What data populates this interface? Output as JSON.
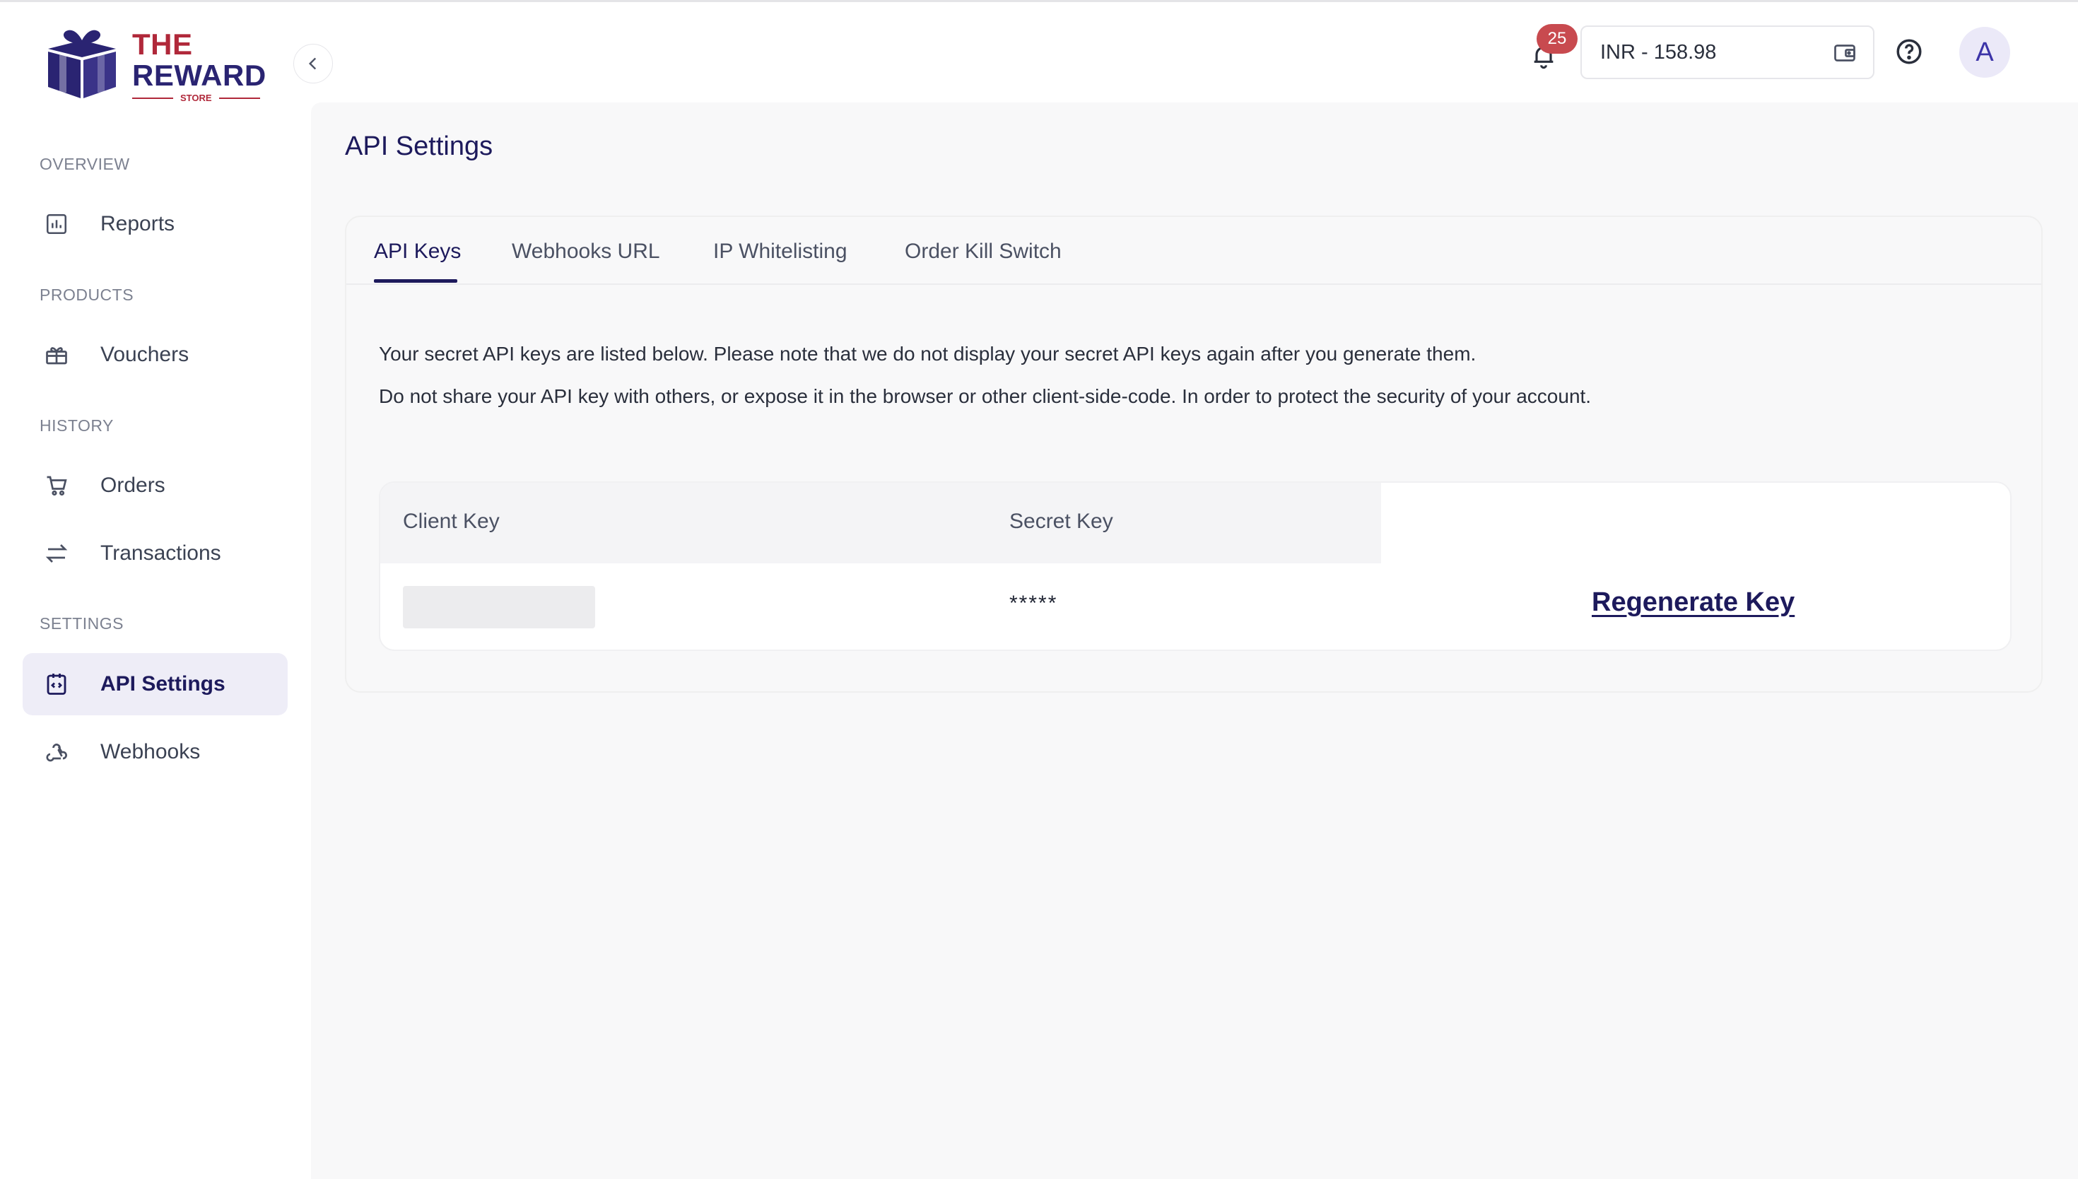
{
  "brand": {
    "line1": "THE",
    "line2": "REWARD",
    "line3": "STORE",
    "colors": {
      "red": "#b0283a",
      "navy": "#2a2472"
    }
  },
  "sidebar": {
    "sections": [
      {
        "label": "OVERVIEW",
        "items": [
          {
            "label": "Reports",
            "icon": "reports-icon"
          }
        ]
      },
      {
        "label": "PRODUCTS",
        "items": [
          {
            "label": "Vouchers",
            "icon": "gift-icon"
          }
        ]
      },
      {
        "label": "HISTORY",
        "items": [
          {
            "label": "Orders",
            "icon": "cart-icon"
          },
          {
            "label": "Transactions",
            "icon": "swap-arrows-icon"
          }
        ]
      },
      {
        "label": "SETTINGS",
        "items": [
          {
            "label": "API Settings",
            "icon": "api-code-icon",
            "active": true
          },
          {
            "label": "Webhooks",
            "icon": "webhook-icon"
          }
        ]
      }
    ]
  },
  "header": {
    "notification_count": "25",
    "wallet_value": "INR - 158.98",
    "avatar_letter": "A",
    "colors": {
      "badge": "#c84a4f",
      "avatar_bg": "#ebe9f8",
      "accent": "#1d1a5c"
    }
  },
  "main": {
    "title": "API Settings",
    "tabs": [
      {
        "label": "API Keys",
        "active": true
      },
      {
        "label": "Webhooks URL"
      },
      {
        "label": "IP Whitelisting"
      },
      {
        "label": "Order Kill Switch"
      }
    ],
    "description": [
      "Your secret API keys are listed below. Please note that we do not display your secret API keys again after you generate them.",
      "Do not share your API key with others, or expose it in the browser or other client-side-code. In order to protect the security of your account."
    ],
    "table": {
      "headers": [
        "Client Key",
        "Secret Key"
      ],
      "row": {
        "client_key": "",
        "secret_key": "*****",
        "action": "Regenerate Key"
      }
    }
  }
}
